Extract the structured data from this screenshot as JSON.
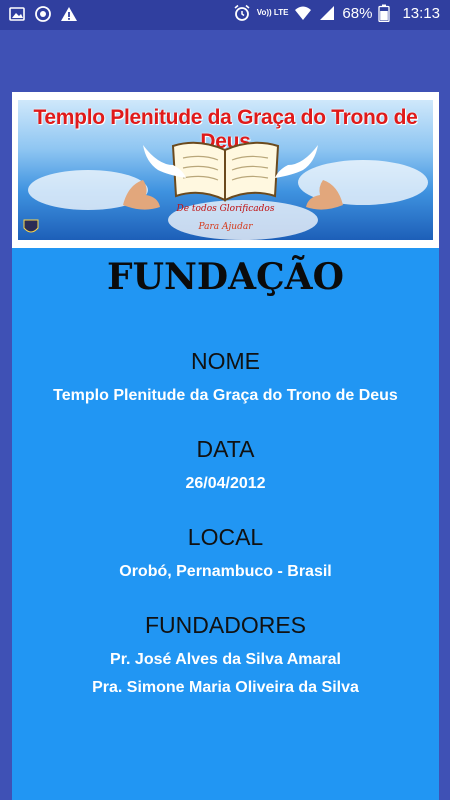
{
  "statusbar": {
    "battery_percent": "68%",
    "time": "13:13",
    "volte_label": "Vo)) LTE",
    "icons": [
      "image-icon",
      "sync-icon",
      "warning-icon",
      "alarm-icon",
      "wifi-icon",
      "signal-icon",
      "battery-icon"
    ]
  },
  "banner": {
    "title": "Templo Plenitude da Graça do Trono de Deus",
    "caption1": "De todos Glorificados",
    "caption2": "Para Ajudar"
  },
  "page": {
    "title": "FUNDAÇÃO",
    "sections": [
      {
        "label": "NOME",
        "values": [
          "Templo Plenitude da Graça do Trono de Deus"
        ]
      },
      {
        "label": "DATA",
        "values": [
          "26/04/2012"
        ]
      },
      {
        "label": "LOCAL",
        "values": [
          "Orobó, Pernambuco - Brasil"
        ]
      },
      {
        "label": "FUNDADORES",
        "values": [
          "Pr. José Alves da Silva Amaral",
          "Pra. Simone Maria Oliveira da Silva"
        ]
      }
    ]
  },
  "colors": {
    "status_bar": "#303f9f",
    "app_background": "#3f51b5",
    "panel": "#2196f3",
    "banner_title": "#e01a1a"
  }
}
